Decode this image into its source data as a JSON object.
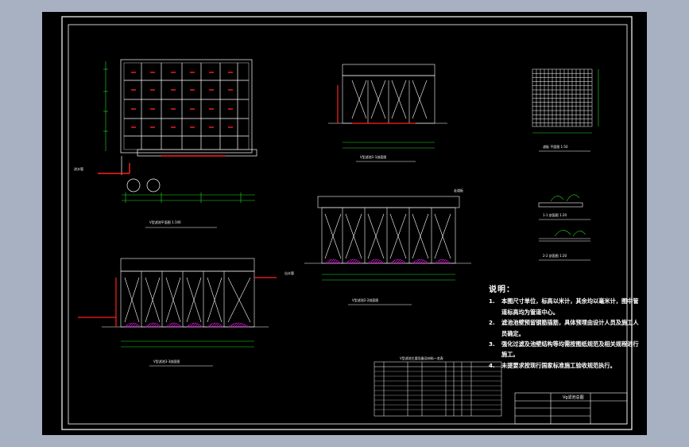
{
  "colors": {
    "background": "#a7b1c2",
    "canvas": "#000000",
    "lines": "#ffffff",
    "pipes": "#ff2020",
    "dimensions": "#20e020",
    "hatch": "#ff20ff"
  },
  "notes": {
    "title": "说明：",
    "items": [
      {
        "num": "1.",
        "text": "本图尺寸单位，标高以米计，其余均以毫米计，图中管道标高均为管道中心。"
      },
      {
        "num": "2.",
        "text": "滤池池壁预留钢筋插筋，具体预埋由设计人员及施工人员确定。"
      },
      {
        "num": "3.",
        "text": "强化过滤及池壁结构等均需按图纸规范及相关规程进行施工。"
      },
      {
        "num": "4.",
        "text": "未提要求按现行国家标准施工验收规范执行。"
      }
    ]
  },
  "title_block": {
    "drawing_title": "Vg滤池总图"
  },
  "captions": {
    "plan": "V型滤池平面图 1:100",
    "section_a": "V型滤池1-1剖面图",
    "section_b": "V型滤池2-2剖面图",
    "section_c": "V型滤池3-3剖面图",
    "filter_plate": "滤板 平面图 1:50",
    "detail_1": "1-1 剖面图 1:20",
    "detail_2": "2-2 剖面图 1:20",
    "materials_table": "V型滤池主要设备及材料一览表"
  },
  "labels": {
    "inlet": "进水管",
    "outlet": "出水管",
    "walkway": "走道板"
  }
}
